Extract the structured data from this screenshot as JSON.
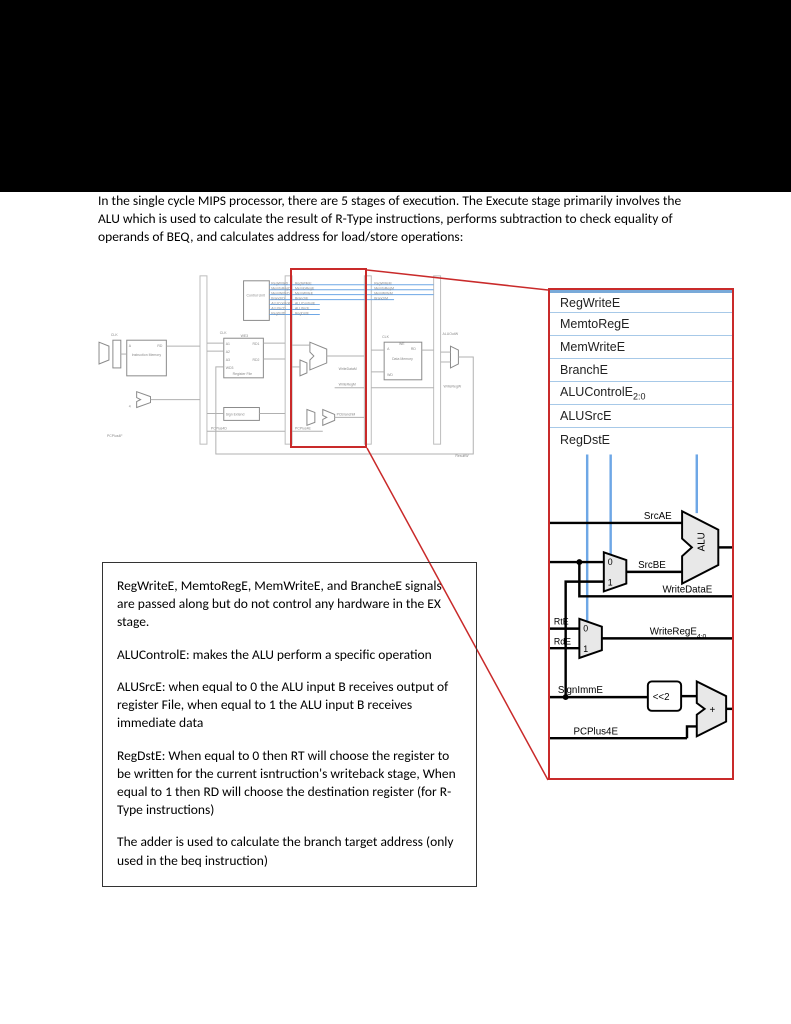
{
  "intro": "In the single cycle MIPS processor, there are 5 stages of execution.  The Execute stage primarily involves the ALU which is used to calculate the result of R-Type instructions, performs subtraction to check equality of operands of BEQ, and calculates address for load/store operations:",
  "overview": {
    "blocks": {
      "instr_mem": "Instruction\nMemory",
      "reg_file": "Register\nFile",
      "sign_extend": "Sign Extend",
      "control_unit": "Control\nUnit",
      "data_mem": "Data\nMemory",
      "clk": "CLK",
      "a": "A",
      "rd": "RD",
      "a1": "A1",
      "a2": "A2",
      "a3": "A3",
      "wd3": "WD3",
      "we3": "WE3",
      "rd1": "RD1",
      "rd2": "RD2",
      "we": "WE",
      "wd": "WD",
      "pcplus4f": "PCPlus4F",
      "pcplus4d": "PCPlus4D",
      "pcplus4e": "PCPlus4E",
      "pcbranchm": "PCBranchM",
      "writeregm": "WriteRegM",
      "writeregw": "WriteRegW",
      "writedatam": "WriteDataM",
      "resultw": "ResultW",
      "aluoutw": "ALUOutW",
      "plus4": "4"
    },
    "control_signals": {
      "s0": "RegWriteD",
      "s1": "MemtoRegD",
      "s2": "MemWriteD",
      "s3": "BranchD",
      "s4": "ALUControlD",
      "s5": "ALUSrcD",
      "s6": "RegDstD",
      "e0": "RegWriteE",
      "e1": "MemtoRegE",
      "e2": "MemWriteE",
      "e3": "BranchE",
      "e4": "ALUControlE",
      "e5": "ALUSrcE",
      "e6": "RegDstE",
      "m0": "RegWriteM",
      "m1": "MemtoRegM",
      "m2": "MemWriteM",
      "m3": "BranchM"
    }
  },
  "detail_signals": {
    "s0": "RegWriteE",
    "s1": "MemtoRegE",
    "s2": "MemWriteE",
    "s3": "BranchE",
    "s4_base": "ALUControlE",
    "s4_sub": "2:0",
    "s5": "ALUSrcE",
    "s6": "RegDstE"
  },
  "detail_labels": {
    "srcae": "SrcAE",
    "srcbe": "SrcBE",
    "writedatae": "WriteDataE",
    "rte": "RtE",
    "rde": "RdE",
    "writerege_base": "WriteRegE",
    "writerege_sub": "4:0",
    "signimme": "SignImmE",
    "pcplus4e": "PCPlus4E",
    "shift": "<<2",
    "plus": "+",
    "alu": "ALU",
    "mux0": "0",
    "mux1": "1"
  },
  "explain": {
    "p1": "RegWriteE, MemtoRegE, MemWriteE, and BrancheE signals are passed along but do not control any hardware in the EX stage.",
    "p2": "ALUControlE: makes the ALU perform a specific operation",
    "p3": "ALUSrcE: when equal to 0 the ALU input B receives output of register File, when equal to 1 the ALU input B receives immediate data",
    "p4": "RegDstE: When equal to 0 then RT will choose the register to be written for the current isntruction's writeback stage, When equal to 1 then RD will choose the destination register (for R-Type instructions)",
    "p5": " The adder is used to calculate the branch target address (only used in the beq instruction)"
  }
}
